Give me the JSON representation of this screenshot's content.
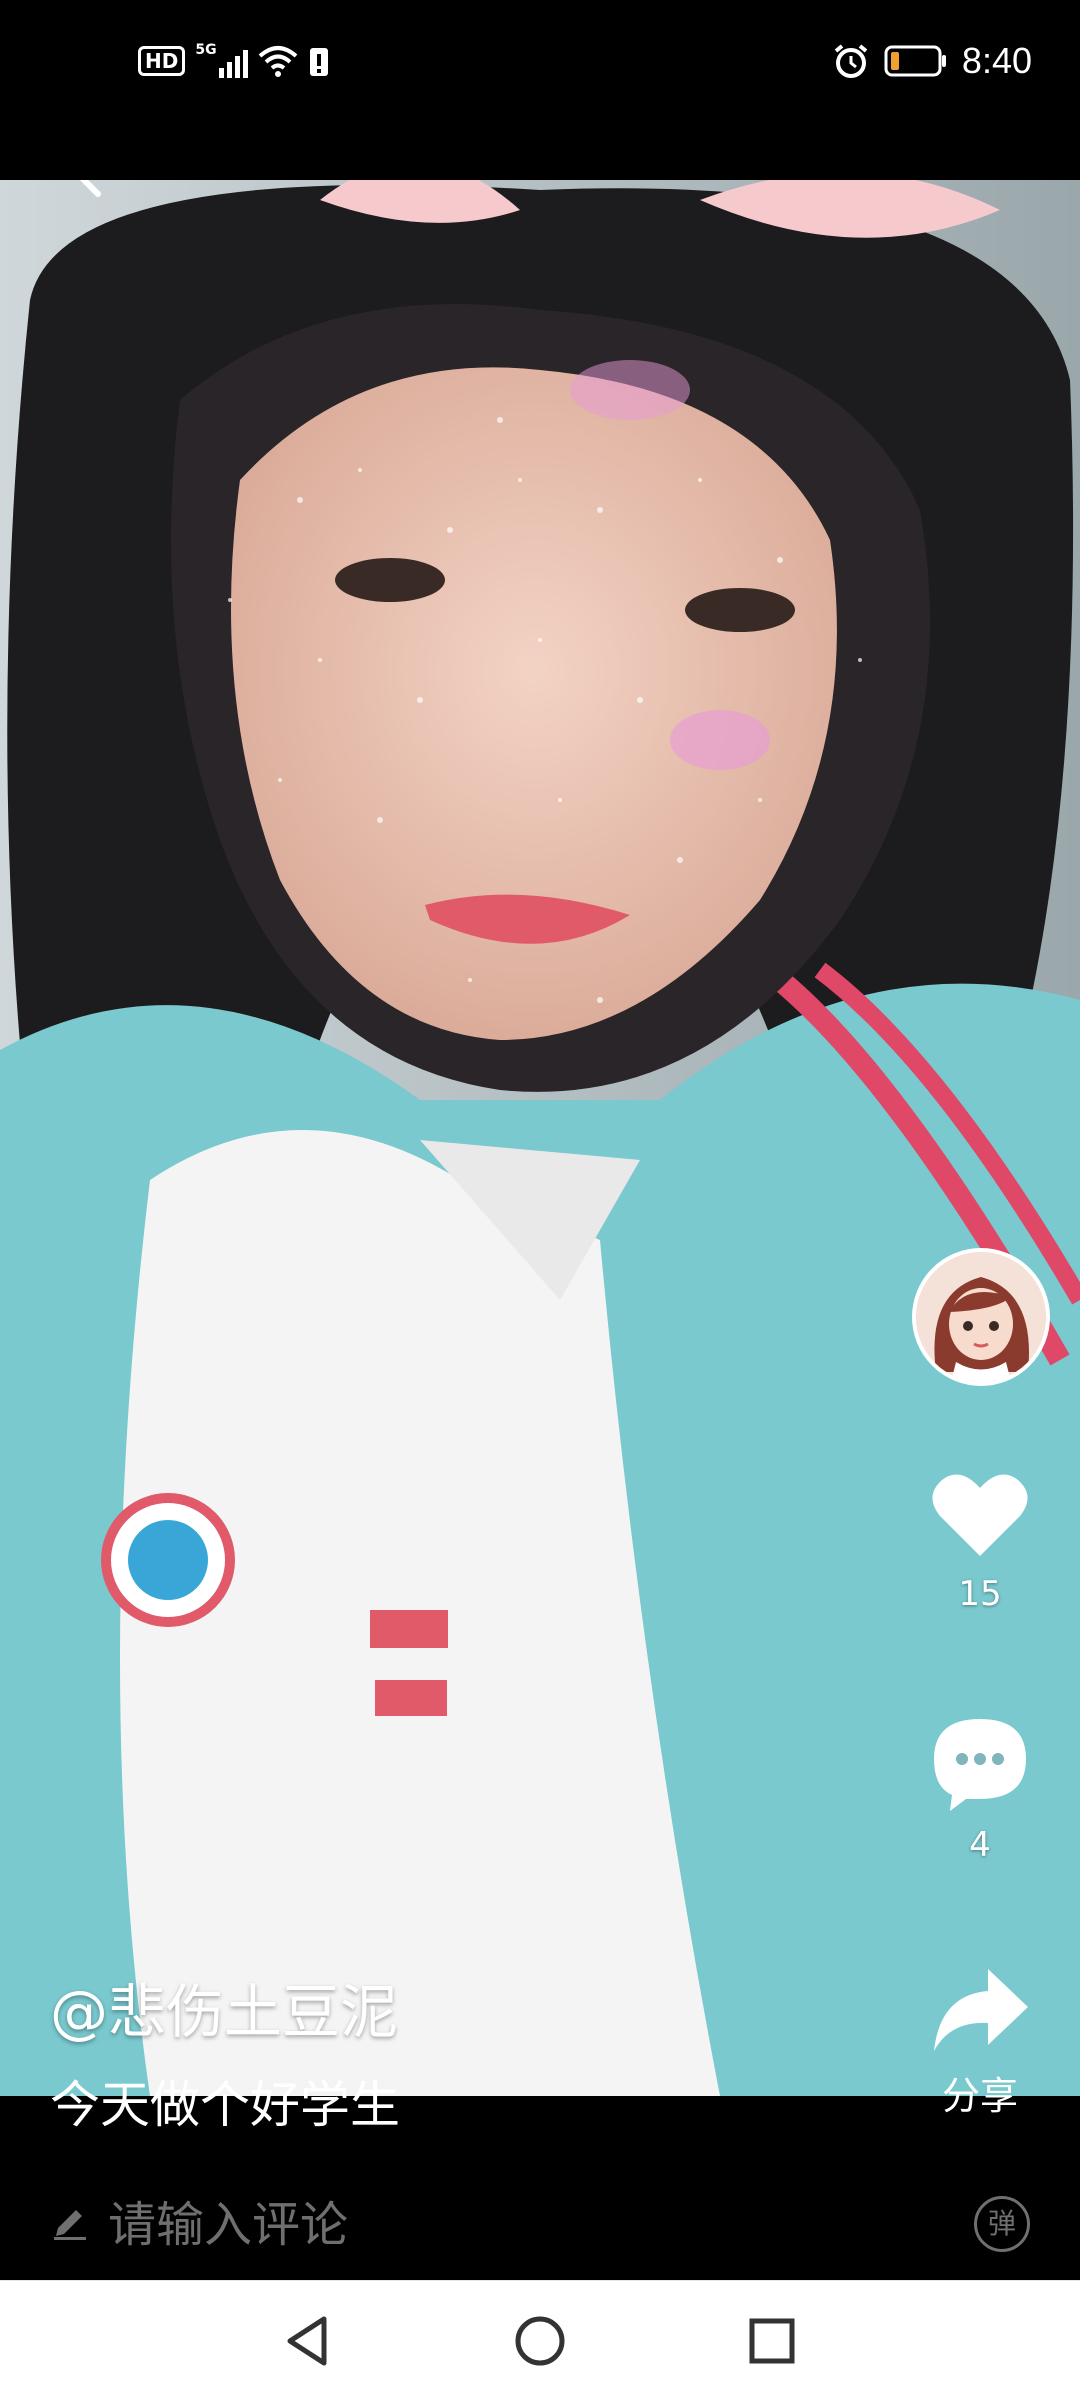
{
  "status_bar": {
    "network_badge": "HD",
    "network_type": "5G",
    "time": "8:40"
  },
  "video": {
    "author": "@悲伤土豆泥",
    "caption": "今天做个好学生"
  },
  "actions": {
    "like_count": "15",
    "comment_count": "4",
    "share_label": "分享"
  },
  "comment_bar": {
    "placeholder": "请输入评论",
    "danmaku_label": "弹"
  },
  "colors": {
    "background": "#000000",
    "placeholder_gray": "#6f6f6f",
    "nav_bar": "#ffffff"
  },
  "icons": [
    "back-icon",
    "like-heart-icon",
    "comment-bubble-icon",
    "share-arrow-icon",
    "pencil-icon",
    "danmaku-icon",
    "nav-back-icon",
    "nav-home-icon",
    "nav-recents-icon"
  ]
}
